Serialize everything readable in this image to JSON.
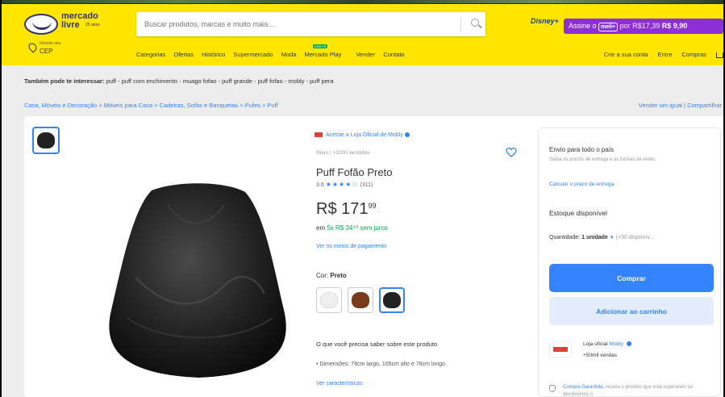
{
  "header": {
    "logo_line1": "mercado",
    "logo_line2": "livre",
    "logo_sub": "25 anos",
    "search_placeholder": "Buscar produtos, marcas e muito mais…",
    "disney_label": "Disney+",
    "promo": {
      "prefix": "Assine o",
      "badge": "meli+",
      "strike": "por R$17,39",
      "price": "R$ 9,90"
    },
    "location_small": "Informe seu",
    "location_big": "CEP",
    "nav": [
      "Categorias",
      "Ofertas",
      "Histórico",
      "Supermercado",
      "Moda",
      "Mercado Play",
      "Vender",
      "Contato"
    ],
    "nav_new_tag": "GRÁTIS",
    "nav_right": [
      "Crie a sua conta",
      "Entre",
      "Compras"
    ]
  },
  "related": {
    "label": "Também pode te interessar:",
    "items": "puff - puff com enchimento - muago fofao - puff grande - puff fofao - mobly - puff pera"
  },
  "breadcrumbs": "Casa, Móveis e Decoração  >  Móveis para Casa  >  Cadeiras, Sofás e Banquetas  >  Pufes  >  Puff",
  "breadcrumb_actions": "Vender um igual  |  Compartilhar",
  "product": {
    "store_link": "Acesse a Loja Oficial de Mobly",
    "condition": "Novo  |  +1000 vendidos",
    "title": "Puff Fofão Preto",
    "rating_value": "3.6",
    "rating_stars": "★★★★☆",
    "rating_count": "(311)",
    "price_currency": "R$ 171",
    "price_cents": "99",
    "installments_prefix": "em",
    "installments_green": "5x R$ 34⁴⁰ sem juros",
    "payment_link": "Ver os meios de pagamento",
    "color_label": "Cor:",
    "color_value": "Preto",
    "swatches": [
      {
        "name": "Branco",
        "color": "#eeeeee"
      },
      {
        "name": "Marrom",
        "color": "#7a3b1c"
      },
      {
        "name": "Preto",
        "color": "#222222"
      }
    ],
    "section_title": "O que você precisa saber sobre este produto",
    "bullet": "•  Dimensões: 78cm largo, 105cm alto e 78cm longo.",
    "charac_link": "Ver características"
  },
  "buybox": {
    "ship_title": "Envio para todo o país",
    "ship_desc": "Saiba os prazos de entrega e as formas de envio.",
    "ship_link": "Calcular o prazo de entrega",
    "stock": "Estoque disponível",
    "qty_label": "Quantidade:",
    "qty_value": "1 unidade",
    "qty_avail": "(+50 disponív...",
    "buy_label": "Comprar",
    "cart_label": "Adicionar ao carrinho",
    "seller_prefix": "Loja oficial",
    "seller_name": "Mobly",
    "seller_sales": "+50mil vendas",
    "guarantee_link": "Compra Garantida,",
    "guarantee_text": "receba o produto que está esperando ou devolvemos o"
  },
  "colors": {
    "brand_yellow": "#ffe600",
    "accent_blue": "#3483fa",
    "promo_purple": "#8d2fd4",
    "green": "#00a650"
  }
}
